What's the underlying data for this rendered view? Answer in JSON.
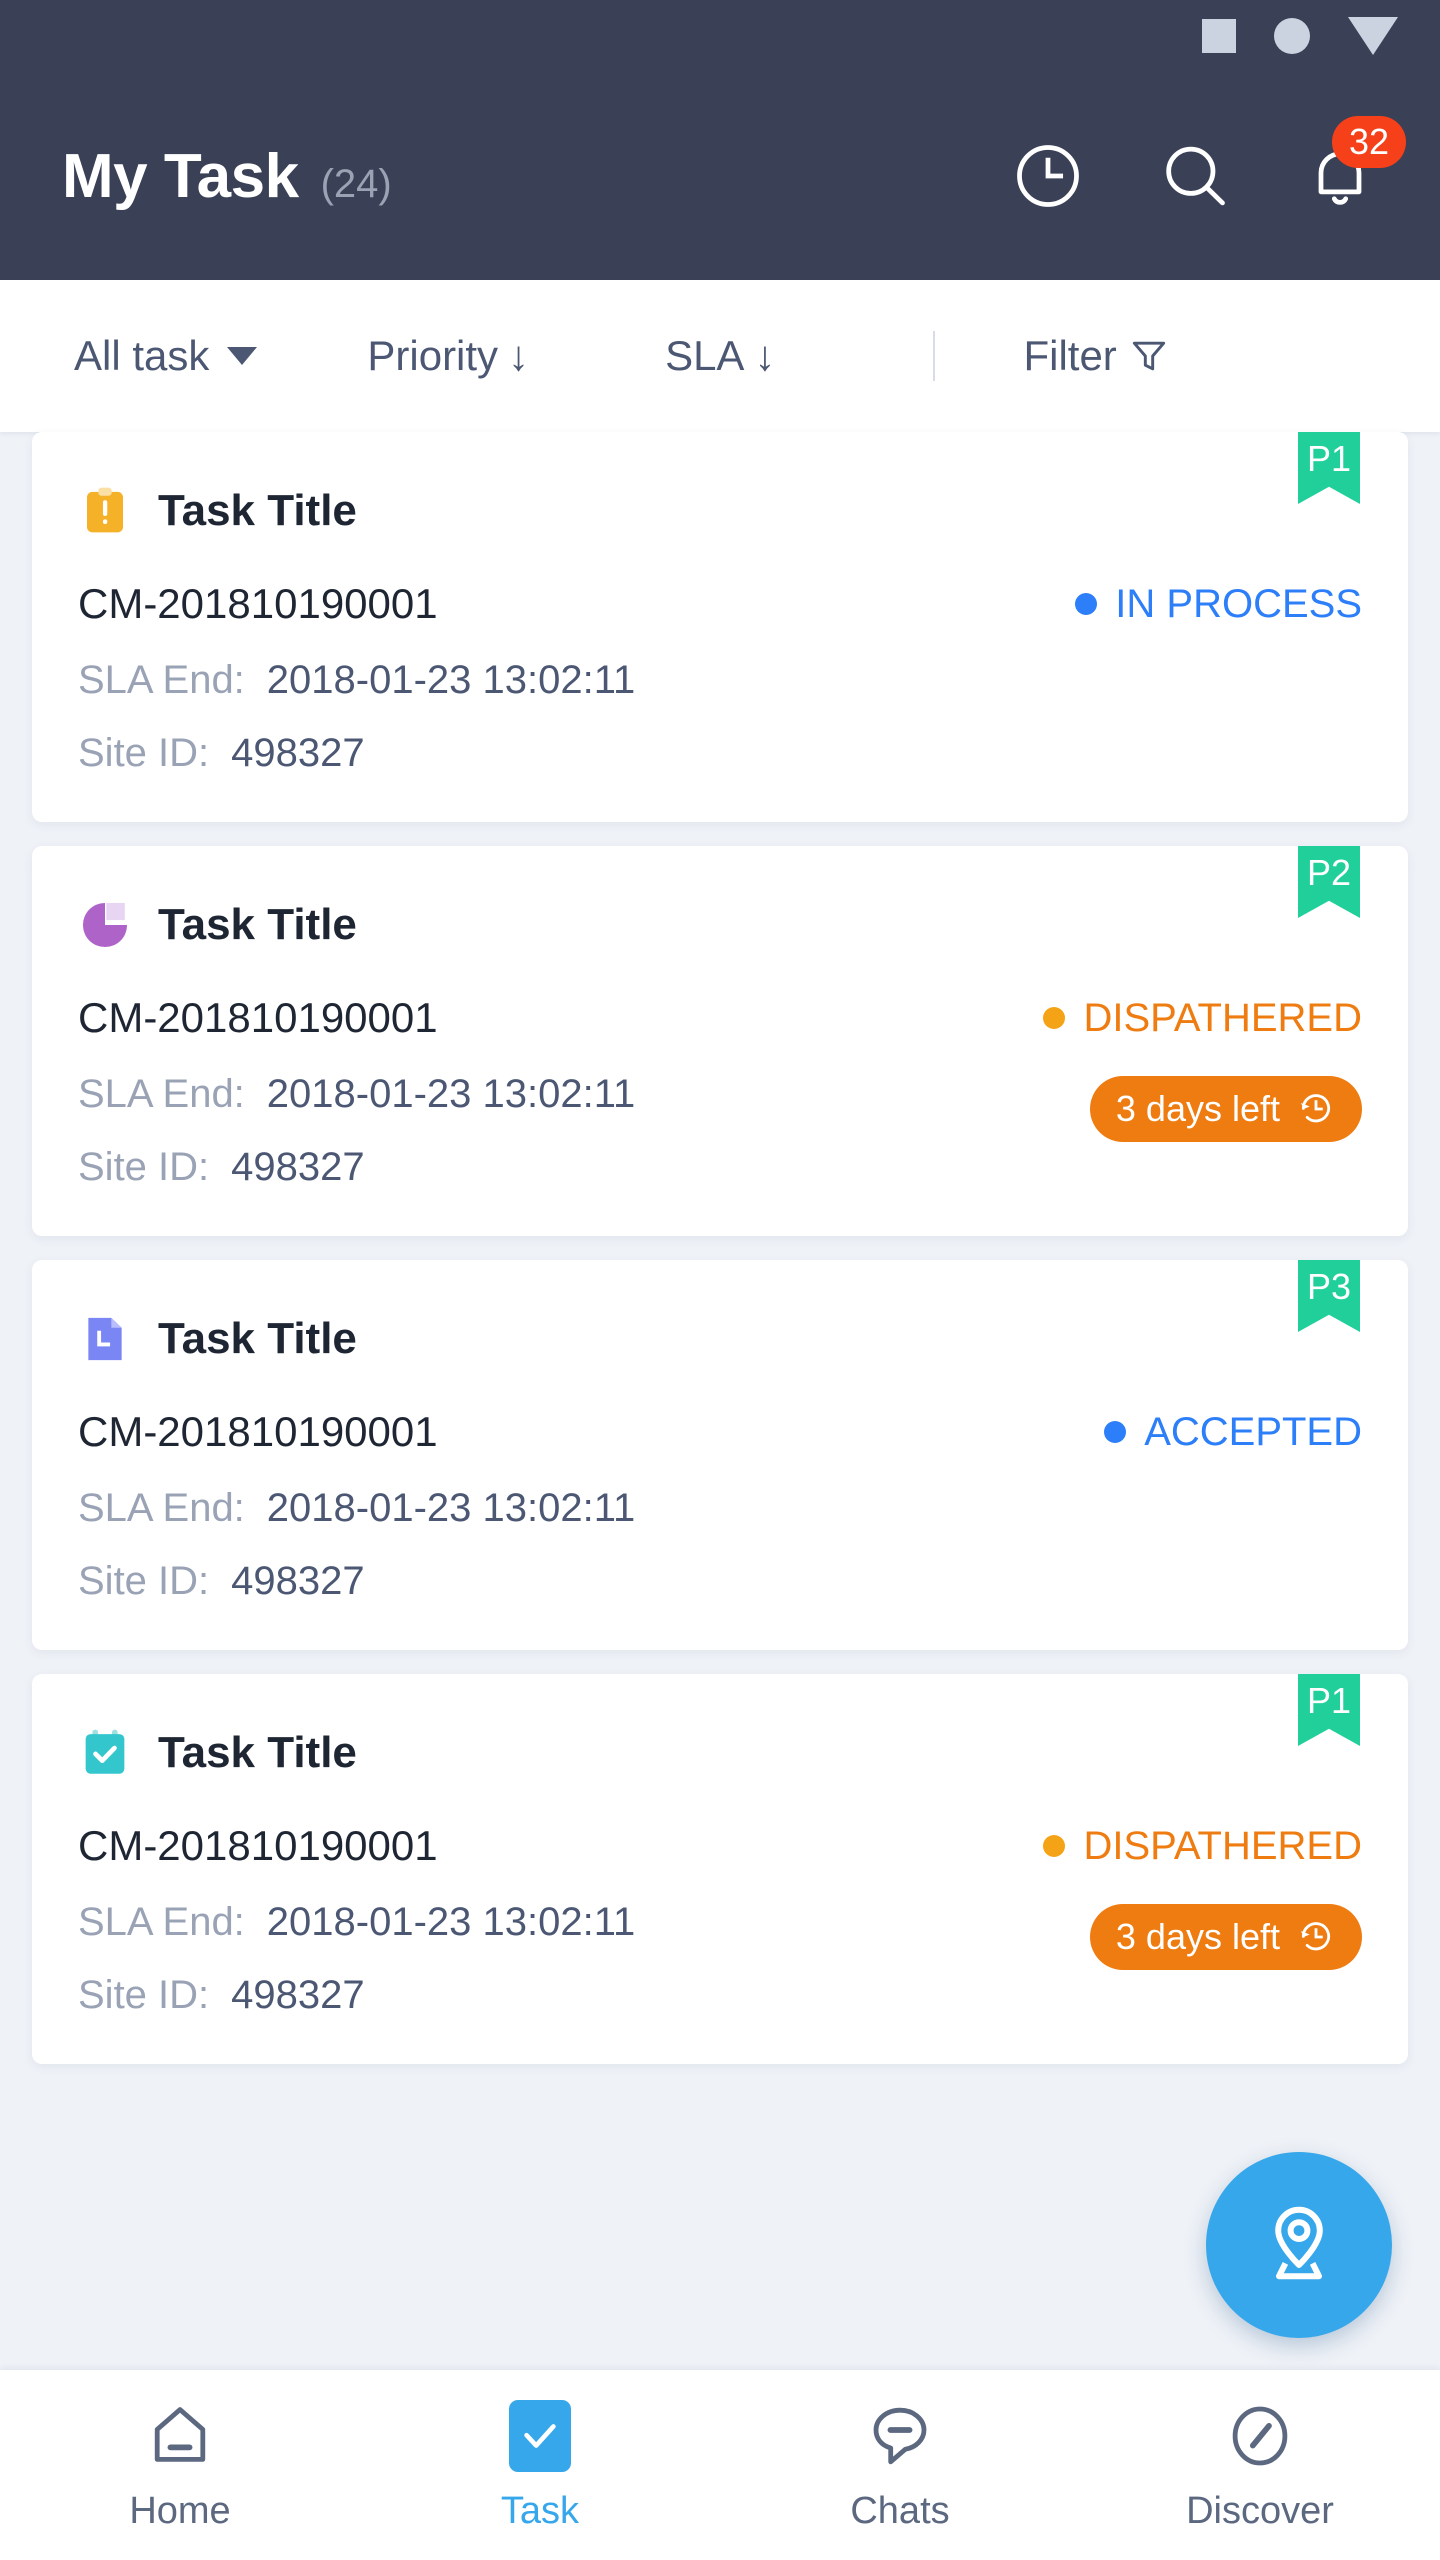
{
  "statusbar": {
    "icons": [
      "square-icon",
      "circle-icon",
      "triangle-down-icon"
    ]
  },
  "header": {
    "title": "My Task",
    "count": "(24)",
    "icons": [
      "clock-icon",
      "search-icon",
      "bell-icon"
    ],
    "notification_badge": "32",
    "bg_color": "#3a4157",
    "badge_color": "#f5401a"
  },
  "filterbar": {
    "all_task": "All task",
    "priority": "Priority",
    "priority_arrow": "↓",
    "sla": "SLA",
    "sla_arrow": "↓",
    "filter": "Filter"
  },
  "labels": {
    "sla_end": "SLA End:",
    "site_id": "Site ID:"
  },
  "colors": {
    "priority_badge": "#20cf9a",
    "status_blue": "#2d7ff9",
    "status_orange": "#ee7c11",
    "accent": "#36a7eb",
    "page_bg": "#eff2f7"
  },
  "tasks": [
    {
      "priority": "P1",
      "icon": "clipboard-alert-icon",
      "title": "Task Title",
      "task_id": "CM-201810190001",
      "status": "IN PROCESS",
      "status_kind": "blue",
      "sla_end": "2018-01-23 13:02:11",
      "site_id": "498327",
      "chip": null
    },
    {
      "priority": "P2",
      "icon": "pie-chart-icon",
      "title": "Task Title",
      "task_id": "CM-201810190001",
      "status": "DISPATHERED",
      "status_kind": "orange",
      "sla_end": "2018-01-23 13:02:11",
      "site_id": "498327",
      "chip": "3 days left"
    },
    {
      "priority": "P3",
      "icon": "document-clock-icon",
      "title": "Task Title",
      "task_id": "CM-201810190001",
      "status": "ACCEPTED",
      "status_kind": "blue",
      "sla_end": "2018-01-23 13:02:11",
      "site_id": "498327",
      "chip": null
    },
    {
      "priority": "P1",
      "icon": "calendar-check-icon",
      "title": "Task Title",
      "task_id": "CM-201810190001",
      "status": "DISPATHERED",
      "status_kind": "orange",
      "sla_end": "2018-01-23 13:02:11",
      "site_id": "498327",
      "chip": "3 days left"
    }
  ],
  "fab": {
    "icon": "location-pin-icon"
  },
  "bottomnav": {
    "items": [
      {
        "label": "Home",
        "icon": "home-icon",
        "active": false
      },
      {
        "label": "Task",
        "icon": "check-icon",
        "active": true
      },
      {
        "label": "Chats",
        "icon": "chat-icon",
        "active": false
      },
      {
        "label": "Discover",
        "icon": "compass-icon",
        "active": false
      }
    ]
  }
}
